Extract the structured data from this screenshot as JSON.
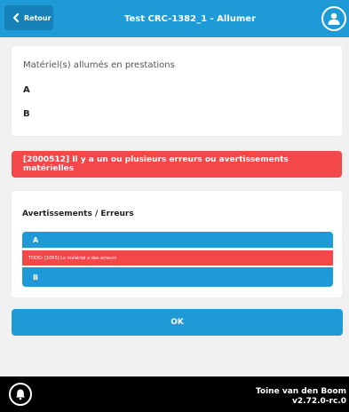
{
  "header": {
    "back_label": "Retour",
    "title": "Test CRC-1382_1 - Allumer"
  },
  "equipment": {
    "caption": "Matériel(s) allumés en prestations",
    "items": [
      "A",
      "B"
    ]
  },
  "error_banner": {
    "text": "[2000512] Il y a un ou plusieurs erreurs ou avertissements matérielles"
  },
  "warnings": {
    "heading": "Avertissements / Erreurs",
    "items": [
      {
        "label": "A",
        "message": "TODO: [1063] Le matériel a des erreurs"
      },
      {
        "label": "B"
      }
    ]
  },
  "ok_button": {
    "label": "OK"
  },
  "footer": {
    "user_name": "Toine van den Boom",
    "version": "v2.72.0-rc.0"
  },
  "colors": {
    "primary": "#1e9ad6",
    "error": "#f2484a",
    "footer": "#000000",
    "background": "#f0f0f0"
  },
  "icons": {
    "back": "chevron-left-icon",
    "user": "user-icon",
    "notifications": "bell-icon"
  }
}
